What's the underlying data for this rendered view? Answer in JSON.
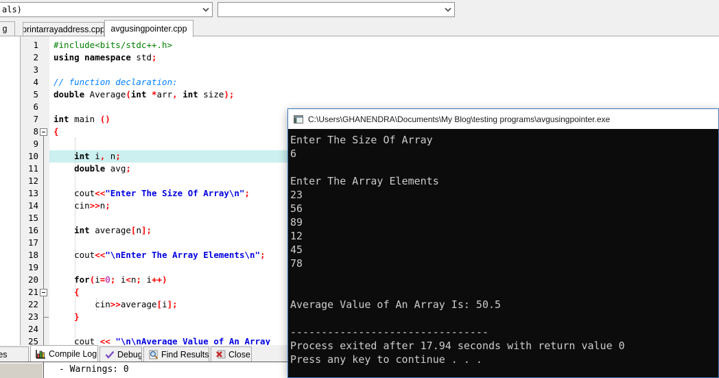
{
  "toolbar": {
    "combo1_value": "als)",
    "combo2_value": ""
  },
  "left_dock": {
    "tab_label": "g"
  },
  "editor": {
    "tabs": [
      {
        "label": "printarrayaddress.cpp",
        "active": false
      },
      {
        "label": "avgusingpointer.cpp",
        "active": true
      }
    ],
    "current_line": 10,
    "fold": {
      "boxes": [
        8,
        21
      ],
      "ticks": [
        23
      ],
      "line_from": 8
    },
    "lines": [
      {
        "n": 1,
        "seg": [
          [
            "pp",
            "#include<bits/stdc++.h>"
          ]
        ]
      },
      {
        "n": 2,
        "seg": [
          [
            "k",
            "using namespace"
          ],
          [
            "t",
            " std"
          ],
          [
            "r",
            ";"
          ]
        ]
      },
      {
        "n": 3,
        "seg": []
      },
      {
        "n": 4,
        "seg": [
          [
            "c",
            "// function declaration:"
          ]
        ]
      },
      {
        "n": 5,
        "seg": [
          [
            "k",
            "double"
          ],
          [
            "t",
            " Average"
          ],
          [
            "r",
            "("
          ],
          [
            "k",
            "int"
          ],
          [
            "t",
            " "
          ],
          [
            "r",
            "*"
          ],
          [
            "t",
            "arr"
          ],
          [
            "r",
            ","
          ],
          [
            "t",
            " "
          ],
          [
            "k",
            "int"
          ],
          [
            "t",
            " size"
          ],
          [
            "r",
            ");"
          ]
        ]
      },
      {
        "n": 6,
        "seg": []
      },
      {
        "n": 7,
        "seg": [
          [
            "k",
            "int"
          ],
          [
            "t",
            " main "
          ],
          [
            "r",
            "()"
          ]
        ]
      },
      {
        "n": 8,
        "seg": [
          [
            "r",
            "{"
          ]
        ]
      },
      {
        "n": 9,
        "seg": []
      },
      {
        "n": 10,
        "seg": [
          [
            "t",
            "    "
          ],
          [
            "k",
            "int"
          ],
          [
            "t",
            " i"
          ],
          [
            "r",
            ","
          ],
          [
            "t",
            " n"
          ],
          [
            "r",
            ";"
          ]
        ]
      },
      {
        "n": 11,
        "seg": [
          [
            "t",
            "    "
          ],
          [
            "k",
            "double"
          ],
          [
            "t",
            " avg"
          ],
          [
            "r",
            ";"
          ]
        ]
      },
      {
        "n": 12,
        "seg": []
      },
      {
        "n": 13,
        "seg": [
          [
            "t",
            "    cout"
          ],
          [
            "r",
            "<<"
          ],
          [
            "s",
            "\"Enter The Size Of Array\\n\""
          ],
          [
            "r",
            ";"
          ]
        ]
      },
      {
        "n": 14,
        "seg": [
          [
            "t",
            "    cin"
          ],
          [
            "r",
            ">>"
          ],
          [
            "t",
            "n"
          ],
          [
            "r",
            ";"
          ]
        ]
      },
      {
        "n": 15,
        "seg": []
      },
      {
        "n": 16,
        "seg": [
          [
            "t",
            "    "
          ],
          [
            "k",
            "int"
          ],
          [
            "t",
            " average"
          ],
          [
            "r",
            "["
          ],
          [
            "t",
            "n"
          ],
          [
            "r",
            "];"
          ]
        ]
      },
      {
        "n": 17,
        "seg": []
      },
      {
        "n": 18,
        "seg": [
          [
            "t",
            "    cout"
          ],
          [
            "r",
            "<<"
          ],
          [
            "s",
            "\"\\nEnter The Array Elements\\n\""
          ],
          [
            "r",
            ";"
          ]
        ]
      },
      {
        "n": 19,
        "seg": []
      },
      {
        "n": 20,
        "seg": [
          [
            "t",
            "    "
          ],
          [
            "k",
            "for"
          ],
          [
            "r",
            "("
          ],
          [
            "t",
            "i"
          ],
          [
            "r",
            "="
          ],
          [
            "n",
            "0"
          ],
          [
            "r",
            ";"
          ],
          [
            "t",
            " i"
          ],
          [
            "r",
            "<"
          ],
          [
            "t",
            "n"
          ],
          [
            "r",
            ";"
          ],
          [
            "t",
            " i"
          ],
          [
            "r",
            "++)"
          ]
        ]
      },
      {
        "n": 21,
        "seg": [
          [
            "t",
            "    "
          ],
          [
            "r",
            "{"
          ]
        ]
      },
      {
        "n": 22,
        "seg": [
          [
            "t",
            "        cin"
          ],
          [
            "r",
            ">>"
          ],
          [
            "t",
            "average"
          ],
          [
            "r",
            "["
          ],
          [
            "t",
            "i"
          ],
          [
            "r",
            "];"
          ]
        ]
      },
      {
        "n": 23,
        "seg": [
          [
            "t",
            "    "
          ],
          [
            "r",
            "}"
          ]
        ]
      },
      {
        "n": 24,
        "seg": []
      },
      {
        "n": 25,
        "seg": [
          [
            "t",
            "    cout "
          ],
          [
            "r",
            "<<"
          ],
          [
            "t",
            " "
          ],
          [
            "s",
            "\"\\n\\nAverage Value of An Array"
          ]
        ]
      }
    ]
  },
  "report_panel": {
    "tabs": [
      {
        "label": "ources",
        "icon": "none",
        "active": false
      },
      {
        "label": "Compile Log",
        "icon": "bar-chart",
        "active": true
      },
      {
        "label": "Debug",
        "icon": "check",
        "active": false
      },
      {
        "label": "Find Results",
        "icon": "search",
        "active": false
      },
      {
        "label": "Close",
        "icon": "close",
        "active": false
      }
    ],
    "log_text": "- Warnings: 0"
  },
  "console": {
    "title": "C:\\Users\\GHANENDRA\\Documents\\My Blog\\testing programs\\avgusingpointer.exe",
    "lines": [
      "Enter The Size Of Array",
      "6",
      "",
      "Enter The Array Elements",
      "23",
      "56",
      "89",
      "12",
      "45",
      "78",
      "",
      "",
      "Average Value of An Array Is: 50.5",
      "",
      "--------------------------------",
      "Process exited after 17.94 seconds with return value 0",
      "Press any key to continue . . ."
    ]
  },
  "colors": {
    "keyword": "#000000",
    "identifier": "#000000",
    "symbol": "#ff0000",
    "string": "#0000e0",
    "comment": "#0080ff",
    "preprocessor": "#008000",
    "number": "#b000b0",
    "current_line_bg": "#ccf0f0",
    "gutter_bg": "#f0f0f0",
    "console_bg": "#0c0c0c",
    "console_fg": "#cccccc",
    "console_border": "#3a79bd"
  }
}
